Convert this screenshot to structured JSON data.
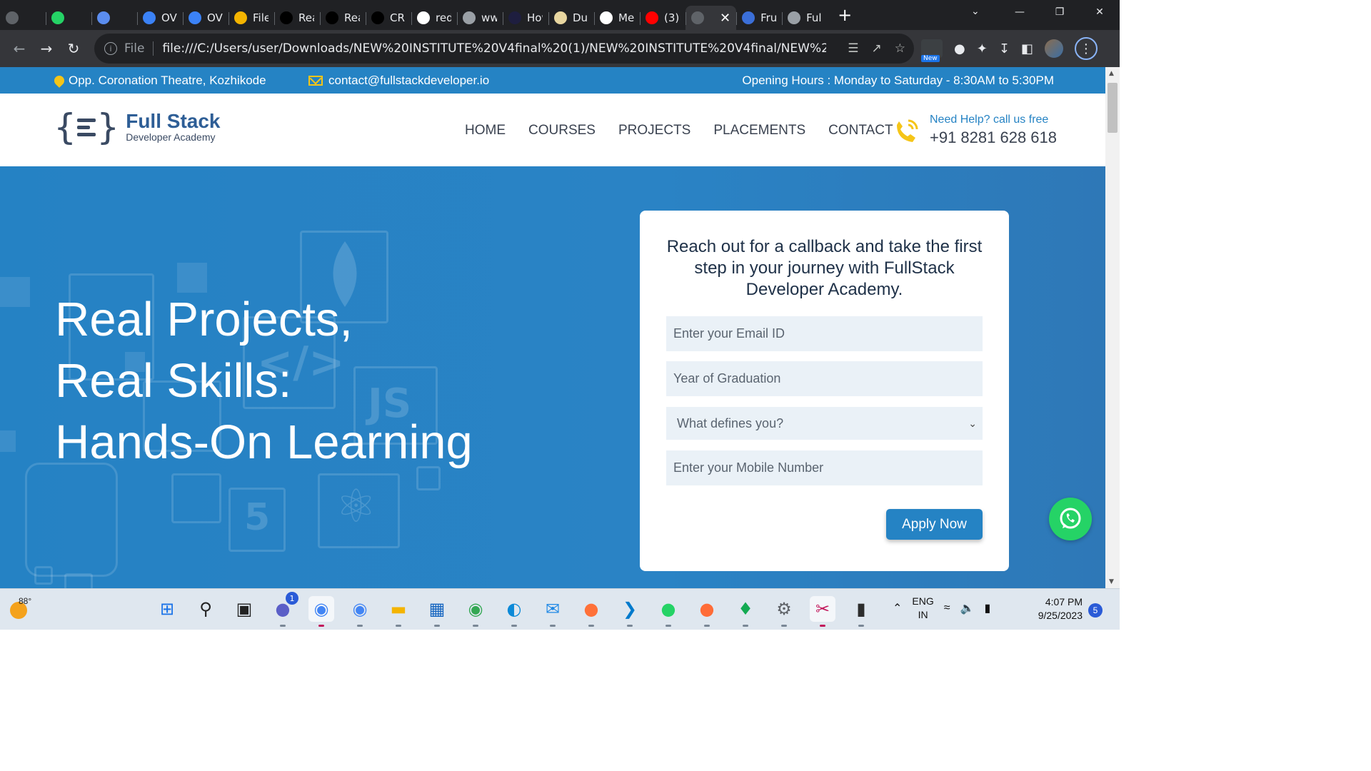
{
  "browser": {
    "tabs": [
      {
        "title": "",
        "icon": "mail-icon",
        "color": "#5f6368"
      },
      {
        "title": "",
        "icon": "whatsapp-icon",
        "color": "#25d366"
      },
      {
        "title": "",
        "icon": "link-icon",
        "color": "#5b8def"
      },
      {
        "title": "OVI",
        "icon": "ovi-icon",
        "color": "#3b82f6"
      },
      {
        "title": "OVI",
        "icon": "ovi-icon",
        "color": "#3b82f6"
      },
      {
        "title": "File",
        "icon": "folder-icon",
        "color": "#f4b400"
      },
      {
        "title": "Rea",
        "icon": "medium-icon",
        "color": "#000000"
      },
      {
        "title": "Rea",
        "icon": "medium-icon",
        "color": "#000000"
      },
      {
        "title": "CRU",
        "icon": "medium-icon",
        "color": "#000000"
      },
      {
        "title": "red",
        "icon": "google-icon",
        "color": "#ffffff"
      },
      {
        "title": "ww",
        "icon": "page-icon",
        "color": "#9aa0a6"
      },
      {
        "title": "How",
        "icon": "lambda-icon",
        "color": "#1e1e3f"
      },
      {
        "title": "Dul",
        "icon": "doc-icon",
        "color": "#e8d6a0"
      },
      {
        "title": "Me",
        "icon": "form-icon",
        "color": "#ffffff"
      },
      {
        "title": "(3)",
        "icon": "youtube-icon",
        "color": "#ff0000"
      },
      {
        "title": "",
        "icon": "fullstack-icon",
        "color": "#5f6368",
        "active": true
      },
      {
        "title": "Fru",
        "icon": "dollar-icon",
        "color": "#3b6fd8"
      },
      {
        "title": "Full",
        "icon": "globe-icon",
        "color": "#9aa0a6"
      }
    ],
    "url_scheme": "File",
    "url": "file:///C:/Users/user/Downloads/NEW%20INSTITUTE%20V4final%20(1)/NEW%20INSTITUTE%20V4final/NEW%20INSTITUT...",
    "ext_new_badge": "New"
  },
  "site": {
    "info": {
      "location": "Opp. Coronation Theatre, Kozhikode",
      "email": "contact@fullstackdeveloper.io",
      "hours": "Opening Hours : Monday to Saturday - 8:30AM to 5:30PM"
    },
    "logo": {
      "title": "Full Stack",
      "subtitle": "Developer Academy"
    },
    "nav": [
      "HOME",
      "COURSES",
      "PROJECTS",
      "PLACEMENTS",
      "CONTACT"
    ],
    "help": {
      "label": "Need Help? call us free",
      "phone": "+91 8281 628 618"
    },
    "hero": {
      "lines": [
        "Real Projects,",
        "Real Skills:",
        "Hands-On Learning"
      ]
    },
    "form": {
      "title": "Reach out for a callback and take the first step in your journey with FullStack Developer Academy.",
      "email_placeholder": "Enter your Email ID",
      "year_placeholder": "Year of Graduation",
      "select_value": "What defines you?",
      "mobile_placeholder": "Enter your Mobile Number",
      "submit": "Apply Now"
    },
    "colors": {
      "primary": "#2583c4",
      "accent": "#f5c518",
      "whatsapp": "#25d366"
    }
  },
  "taskbar": {
    "weather_temp": "88°",
    "apps": [
      {
        "name": "start-icon",
        "color": "#1a73e8"
      },
      {
        "name": "search-icon",
        "color": "#222222"
      },
      {
        "name": "task-view-icon",
        "color": "#222222"
      },
      {
        "name": "teams-chat-icon",
        "color": "#5b5fc7",
        "badge": "1"
      },
      {
        "name": "chrome-icon",
        "color": "#4285f4",
        "active": true
      },
      {
        "name": "chrome-icon",
        "color": "#4285f4"
      },
      {
        "name": "file-explorer-icon",
        "color": "#f4b400"
      },
      {
        "name": "store-icon",
        "color": "#1565c0"
      },
      {
        "name": "chrome-profile-icon",
        "color": "#34a853"
      },
      {
        "name": "edge-icon",
        "color": "#0c8ad8"
      },
      {
        "name": "mail-icon",
        "color": "#1e88e5"
      },
      {
        "name": "firefox-icon",
        "color": "#ff7139"
      },
      {
        "name": "vscode-icon",
        "color": "#007acc"
      },
      {
        "name": "whatsapp-icon",
        "color": "#25d366"
      },
      {
        "name": "postman-icon",
        "color": "#ff6c37"
      },
      {
        "name": "mongodb-icon",
        "color": "#13aa52"
      },
      {
        "name": "settings-icon",
        "color": "#5f6368"
      },
      {
        "name": "snipping-icon",
        "color": "#c2185b",
        "active": true
      },
      {
        "name": "terminal-icon",
        "color": "#2d2d2d"
      }
    ],
    "lang_top": "ENG",
    "lang_bottom": "IN",
    "time": "4:07 PM",
    "date": "9/25/2023",
    "notifications": "5"
  }
}
